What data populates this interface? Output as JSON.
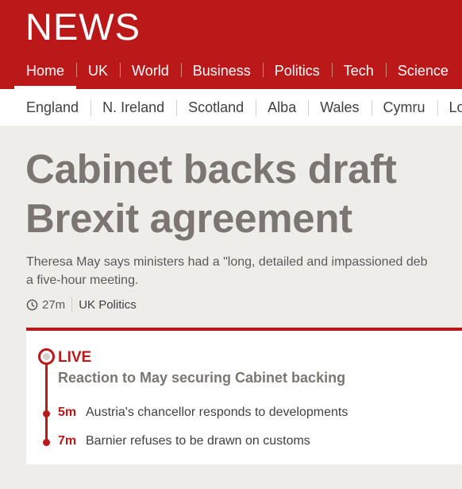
{
  "brand": {
    "logo": "NEWS"
  },
  "primary_nav": [
    "Home",
    "UK",
    "World",
    "Business",
    "Politics",
    "Tech",
    "Science"
  ],
  "secondary_nav": [
    "England",
    "N. Ireland",
    "Scotland",
    "Alba",
    "Wales",
    "Cymru",
    "Lo"
  ],
  "article": {
    "headline": "Cabinet backs draft Brexit agreement",
    "summary_line1": "Theresa May says ministers had a \"long, detailed and impassioned deb",
    "summary_line2": "a five-hour meeting.",
    "time": "27m",
    "section": "UK Politics",
    "icon": "clock-icon"
  },
  "live": {
    "label": "LIVE",
    "title": "Reaction to May securing Cabinet backing",
    "updates": [
      {
        "time": "5m",
        "text": "Austria's chancellor responds to developments"
      },
      {
        "time": "7m",
        "text": "Barnier refuses to be drawn on customs"
      }
    ]
  },
  "colors": {
    "brand_red": "#bb1919",
    "headline_grey": "#7b7671",
    "page_bg": "#efedea"
  }
}
